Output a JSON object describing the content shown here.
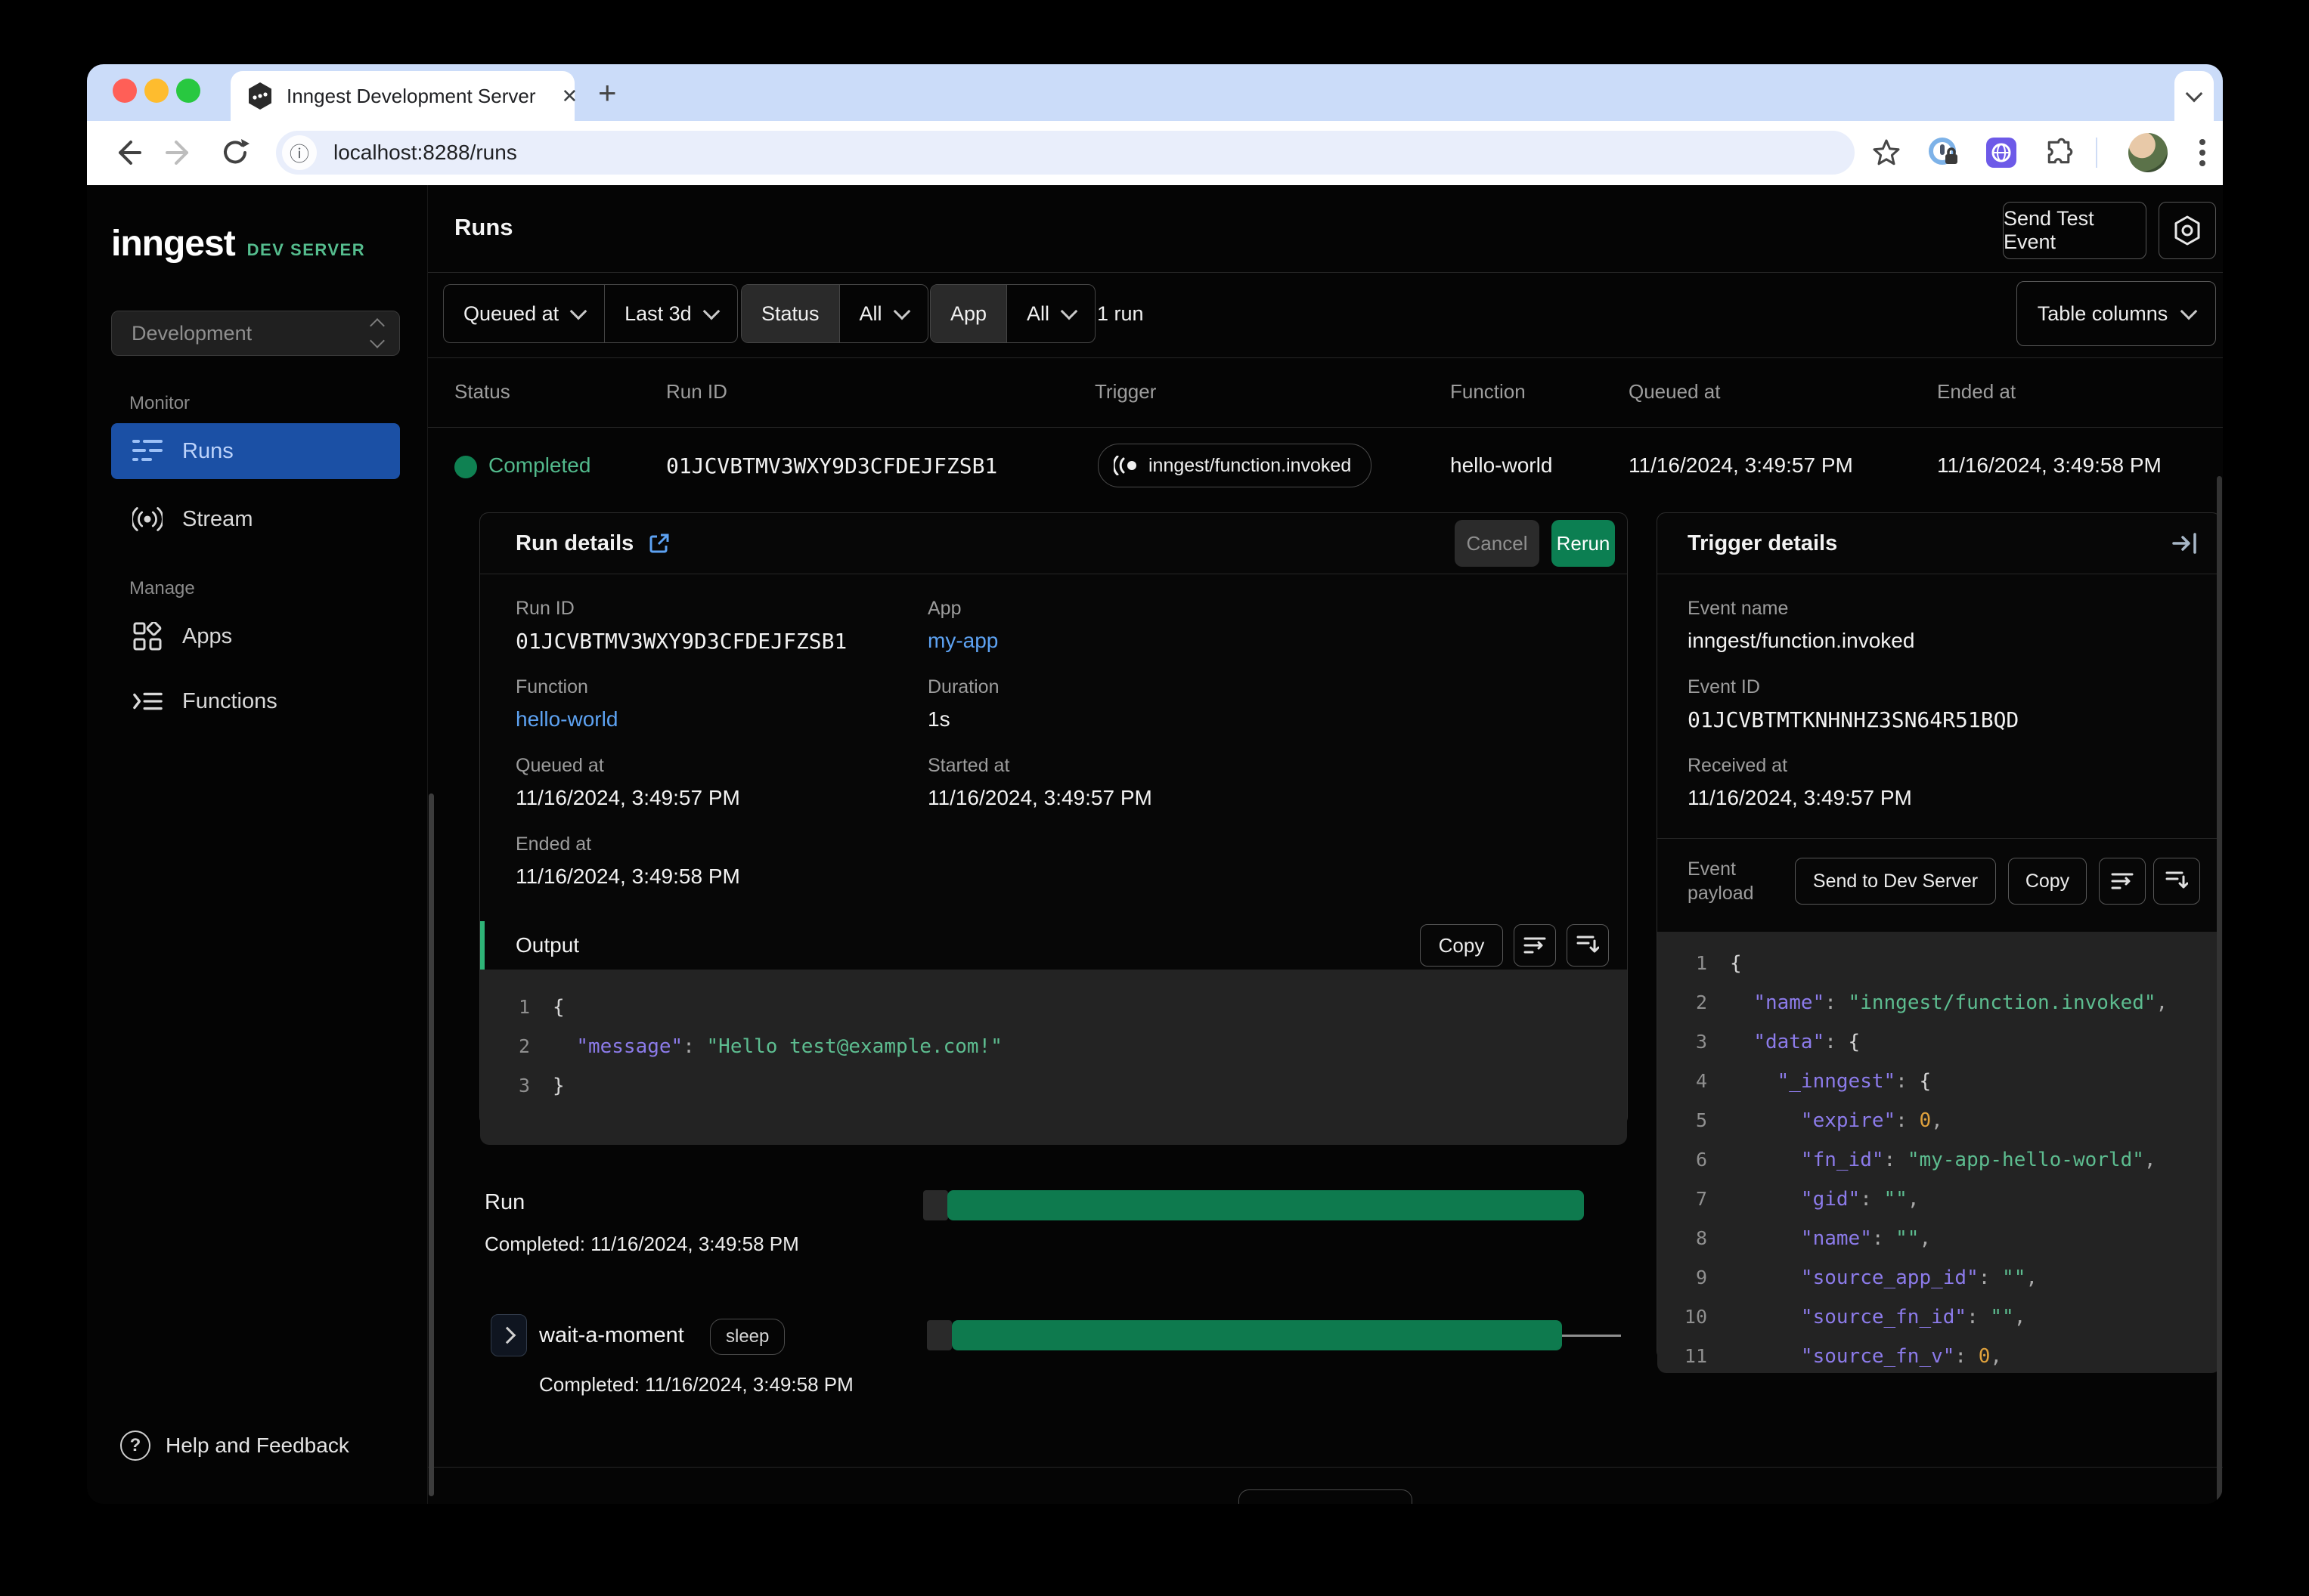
{
  "browser": {
    "tab_title": "Inngest Development Server",
    "url": "localhost:8288/runs"
  },
  "sidebar": {
    "logo": "inngest",
    "logo_badge": "DEV SERVER",
    "env_select": "Development",
    "monitor_label": "Monitor",
    "runs": "Runs",
    "stream": "Stream",
    "manage_label": "Manage",
    "apps": "Apps",
    "functions": "Functions",
    "help": "Help and Feedback"
  },
  "header": {
    "title": "Runs",
    "send_test_event": "Send Test Event"
  },
  "filters": {
    "field": "Queued at",
    "range": "Last 3d",
    "status_label": "Status",
    "status_value": "All",
    "app_label": "App",
    "app_value": "All",
    "count": "1 run",
    "table_columns": "Table columns"
  },
  "table": {
    "headers": [
      "Status",
      "Run ID",
      "Trigger",
      "Function",
      "Queued at",
      "Ended at"
    ],
    "row": {
      "status": "Completed",
      "run_id": "01JCVBTMV3WXY9D3CFDEJFZSB1",
      "trigger": "inngest/function.invoked",
      "function": "hello-world",
      "queued_at": "11/16/2024, 3:49:57 PM",
      "ended_at": "11/16/2024, 3:49:58 PM"
    }
  },
  "run_details": {
    "title": "Run details",
    "cancel": "Cancel",
    "rerun": "Rerun",
    "run_id_label": "Run ID",
    "run_id": "01JCVBTMV3WXY9D3CFDEJFZSB1",
    "app_label": "App",
    "app": "my-app",
    "function_label": "Function",
    "function": "hello-world",
    "duration_label": "Duration",
    "duration": "1s",
    "queued_label": "Queued at",
    "queued": "11/16/2024, 3:49:57 PM",
    "started_label": "Started at",
    "started": "11/16/2024, 3:49:57 PM",
    "ended_label": "Ended at",
    "ended": "11/16/2024, 3:49:58 PM",
    "output": {
      "title": "Output",
      "copy": "Copy",
      "lines": [
        [
          [
            "{",
            "b"
          ]
        ],
        [
          [
            "  ",
            "p"
          ],
          [
            "\"message\"",
            "k"
          ],
          [
            ":",
            "p"
          ],
          [
            " ",
            "p"
          ],
          [
            "\"Hello test@example.com!\"",
            "s"
          ]
        ],
        [
          [
            "}",
            "b"
          ]
        ]
      ]
    }
  },
  "timeline": {
    "run_label": "Run",
    "run_completed": "Completed: 11/16/2024, 3:49:58 PM",
    "step_name": "wait-a-moment",
    "step_kind": "sleep",
    "step_completed": "Completed: 11/16/2024, 3:49:58 PM"
  },
  "trigger_details": {
    "title": "Trigger details",
    "event_name_label": "Event name",
    "event_name": "inngest/function.invoked",
    "event_id_label": "Event ID",
    "event_id": "01JCVBTMTKNHNHZ3SN64R51BQD",
    "received_label": "Received at",
    "received": "11/16/2024, 3:49:57 PM",
    "payload": {
      "title": "Event payload",
      "send": "Send to Dev Server",
      "copy": "Copy",
      "lines": [
        [
          [
            "{",
            "b"
          ]
        ],
        [
          [
            "  ",
            "p"
          ],
          [
            "\"name\"",
            "k"
          ],
          [
            ":",
            "p"
          ],
          [
            " ",
            "p"
          ],
          [
            "\"inngest/function.invoked\"",
            "s"
          ],
          [
            ",",
            "p"
          ]
        ],
        [
          [
            "  ",
            "p"
          ],
          [
            "\"data\"",
            "k"
          ],
          [
            ":",
            "p"
          ],
          [
            " {",
            "b"
          ]
        ],
        [
          [
            "    ",
            "p"
          ],
          [
            "\"_inngest\"",
            "k"
          ],
          [
            ":",
            "p"
          ],
          [
            " {",
            "b"
          ]
        ],
        [
          [
            "      ",
            "p"
          ],
          [
            "\"expire\"",
            "k"
          ],
          [
            ":",
            "p"
          ],
          [
            " ",
            "p"
          ],
          [
            "0",
            "n"
          ],
          [
            ",",
            "p"
          ]
        ],
        [
          [
            "      ",
            "p"
          ],
          [
            "\"fn_id\"",
            "k"
          ],
          [
            ":",
            "p"
          ],
          [
            " ",
            "p"
          ],
          [
            "\"my-app-hello-world\"",
            "s"
          ],
          [
            ",",
            "p"
          ]
        ],
        [
          [
            "      ",
            "p"
          ],
          [
            "\"gid\"",
            "k"
          ],
          [
            ":",
            "p"
          ],
          [
            " ",
            "p"
          ],
          [
            "\"\"",
            "s"
          ],
          [
            ",",
            "p"
          ]
        ],
        [
          [
            "      ",
            "p"
          ],
          [
            "\"name\"",
            "k"
          ],
          [
            ":",
            "p"
          ],
          [
            " ",
            "p"
          ],
          [
            "\"\"",
            "s"
          ],
          [
            ",",
            "p"
          ]
        ],
        [
          [
            "      ",
            "p"
          ],
          [
            "\"source_app_id\"",
            "k"
          ],
          [
            ":",
            "p"
          ],
          [
            " ",
            "p"
          ],
          [
            "\"\"",
            "s"
          ],
          [
            ",",
            "p"
          ]
        ],
        [
          [
            "      ",
            "p"
          ],
          [
            "\"source_fn_id\"",
            "k"
          ],
          [
            ":",
            "p"
          ],
          [
            " ",
            "p"
          ],
          [
            "\"\"",
            "s"
          ],
          [
            ",",
            "p"
          ]
        ],
        [
          [
            "      ",
            "p"
          ],
          [
            "\"source_fn_v\"",
            "k"
          ],
          [
            ":",
            "p"
          ],
          [
            " ",
            "p"
          ],
          [
            "0",
            "n"
          ],
          [
            ",",
            "p"
          ]
        ]
      ]
    }
  },
  "colors": {
    "accent_green": "#2eb477",
    "bar_green": "#0e7a4e",
    "rerun_green": "#0c7f52",
    "status_green": "#52ba8c",
    "link_blue": "#5da2f2",
    "active_nav_blue": "#1b50a5",
    "code_key_purple": "#8c7bea",
    "code_string_green": "#5dbd90",
    "code_number_orange": "#dfa13c",
    "tabbar_blue": "#cbdcf9"
  }
}
